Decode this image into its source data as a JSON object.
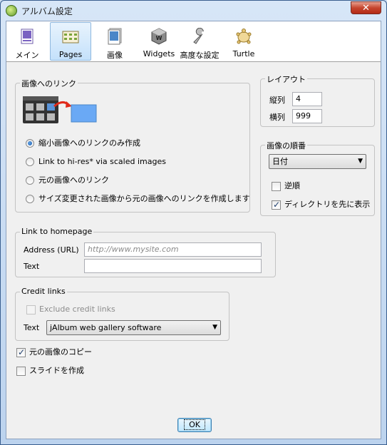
{
  "window": {
    "title": "アルバム設定",
    "close_symbol": "✕"
  },
  "toolbar": {
    "items": [
      {
        "label": "メイン",
        "icon": "main-icon",
        "active": false
      },
      {
        "label": "Pages",
        "icon": "pages-icon",
        "active": true
      },
      {
        "label": "画像",
        "icon": "images-icon",
        "active": false
      },
      {
        "label": "Widgets",
        "icon": "widgets-icon",
        "active": false
      },
      {
        "label": "高度な設定",
        "icon": "wrench-icon",
        "active": false
      },
      {
        "label": "Turtle",
        "icon": "turtle-icon",
        "active": false
      }
    ]
  },
  "image_link": {
    "legend": "画像へのリンク",
    "options": [
      {
        "label": "縮小画像へのリンクのみ作成",
        "selected": true
      },
      {
        "label": "Link to hi-res* via scaled images",
        "selected": false
      },
      {
        "label": "元の画像へのリンク",
        "selected": false
      },
      {
        "label": "サイズ変更された画像から元の画像へのリンクを作成します",
        "selected": false
      }
    ]
  },
  "layout": {
    "legend": "レイアウト",
    "columns_label": "縦列",
    "columns_value": "4",
    "rows_label": "横列",
    "rows_value": "999"
  },
  "image_order": {
    "legend": "画像の順番",
    "sort_value": "日付",
    "reverse_label": "逆順",
    "reverse_checked": false,
    "dirs_first_label": "ディレクトリを先に表示",
    "dirs_first_checked": true
  },
  "homepage": {
    "legend": "Link to homepage",
    "address_label": "Address (URL)",
    "address_placeholder": "http://www.mysite.com",
    "text_label": "Text",
    "text_value": ""
  },
  "credit": {
    "legend": "Credit links",
    "exclude_label": "Exclude credit links",
    "exclude_checked": false,
    "text_label": "Text",
    "text_value": "jAlbum web gallery software"
  },
  "options": {
    "copy_originals_label": "元の画像のコピー",
    "copy_originals_checked": true,
    "slides_label": "スライドを作成",
    "slides_checked": false
  },
  "footer": {
    "ok_label": "OK"
  },
  "colors": {
    "accent": "#6aa9f5",
    "title_bg": "#bcd3ee",
    "close_red": "#c6462f"
  }
}
